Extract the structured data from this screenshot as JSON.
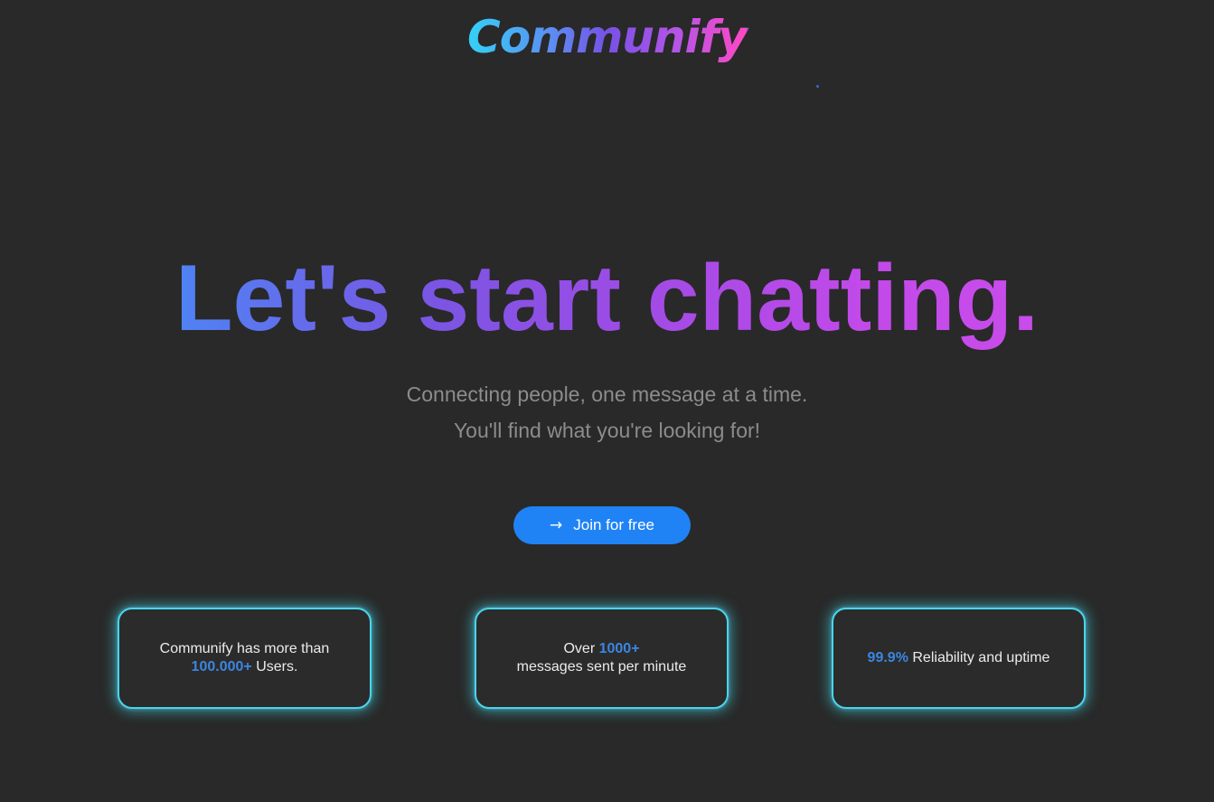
{
  "brand": {
    "name": "Communify"
  },
  "hero": {
    "headline": "Let's start chatting.",
    "subline_1": "Connecting people, one message at a time.",
    "subline_2": "You'll find what you're looking for!",
    "cta_label": "Join for free",
    "cta_icon": "arrow-right-icon"
  },
  "stats": [
    {
      "prefix": "Communify has more than",
      "highlight": "100.000+",
      "suffix": "Users."
    },
    {
      "prefix": "Over",
      "highlight": "1000+",
      "suffix": "messages sent per minute"
    },
    {
      "highlight": "99.9%",
      "suffix": "Reliability and uptime"
    }
  ],
  "colors": {
    "background": "#292929",
    "accent": "#1f83f5",
    "highlight": "#3b86e0",
    "card_glow": "#49d6e8"
  }
}
